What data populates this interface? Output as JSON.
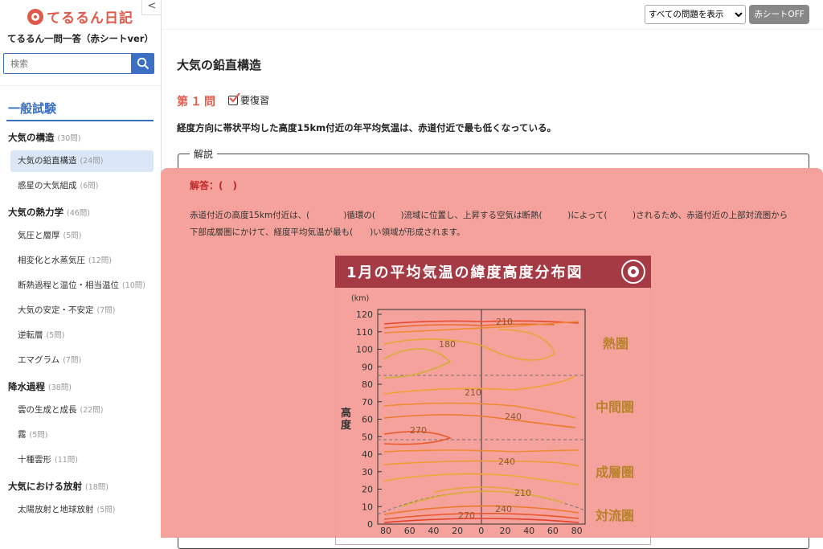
{
  "app": {
    "logo_text": "てるるん日記",
    "collapse_icon": "<",
    "subtitle": "てるるん一問一答（赤シートver）"
  },
  "search": {
    "placeholder": "検索"
  },
  "sidebar": {
    "section_title": "一般試験",
    "entries": [
      {
        "type": "cat",
        "label": "大気の構造",
        "count": "(30問)"
      },
      {
        "type": "item",
        "label": "大気の鉛直構造",
        "count": "(24問)",
        "active": true
      },
      {
        "type": "item",
        "label": "惑星の大気組成",
        "count": "(6問)"
      },
      {
        "type": "cat",
        "label": "大気の熱力学",
        "count": "(46問)"
      },
      {
        "type": "item",
        "label": "気圧と層厚",
        "count": "(5問)"
      },
      {
        "type": "item",
        "label": "相変化と水蒸気圧",
        "count": "(12問)"
      },
      {
        "type": "item",
        "label": "断熱過程と温位・相当温位",
        "count": "(10問)"
      },
      {
        "type": "item",
        "label": "大気の安定・不安定",
        "count": "(7問)"
      },
      {
        "type": "item",
        "label": "逆転層",
        "count": "(5問)"
      },
      {
        "type": "item",
        "label": "エマグラム",
        "count": "(7問)"
      },
      {
        "type": "cat",
        "label": "降水過程",
        "count": "(38問)"
      },
      {
        "type": "item",
        "label": "雲の生成と成長",
        "count": "(22問)"
      },
      {
        "type": "item",
        "label": "霧",
        "count": "(5問)"
      },
      {
        "type": "item",
        "label": "十種雲形",
        "count": "(11問)"
      },
      {
        "type": "cat",
        "label": "大気における放射",
        "count": "(18問)"
      },
      {
        "type": "item",
        "label": "太陽放射と地球放射",
        "count": "(5問)"
      }
    ]
  },
  "toolbar": {
    "filter_selected": "すべての問題を表示",
    "red_sheet_label": "赤シートOFF"
  },
  "main": {
    "page_title": "大気の鉛直構造",
    "question_number": "第１問",
    "review_label": "要復習",
    "review_checked": true,
    "question_text": "経度方向に帯状平均した高度15km付近の年平均気温は、赤道付近で最も低くなっている。",
    "explanation_legend": "解説",
    "answer_label": "解答：(　)",
    "explanation_text": "赤道付近の高度15km付近は、(　　　　)循環の(　　　)流域に位置し、上昇する空気は断熱(　　　)によって(　　　)されるため、赤道付近の上部対流圏から下部成層圏にかけて、経度平均気温が最も(　　)い領域が形成されます。"
  },
  "figure": {
    "title": "1月の平均気温の緯度高度分布図",
    "unit": "(km)",
    "ylabel": "高度",
    "yticks": [
      "120",
      "110",
      "100",
      "90",
      "80",
      "70",
      "60",
      "50",
      "40",
      "30",
      "20",
      "10",
      "0"
    ],
    "xticks": [
      "80",
      "60",
      "40",
      "20",
      "0",
      "20",
      "40",
      "60",
      "80"
    ],
    "layers": [
      "熱圏",
      "中間圏",
      "成層圏",
      "対流圏"
    ],
    "contour_labels": [
      "210",
      "180",
      "210",
      "240",
      "270",
      "240",
      "210",
      "240",
      "270"
    ]
  },
  "colors": {
    "accent": "#3a6fc4",
    "brand": "#e0594a",
    "red_sheet": "#f4a29b",
    "banner": "#a53a44"
  }
}
